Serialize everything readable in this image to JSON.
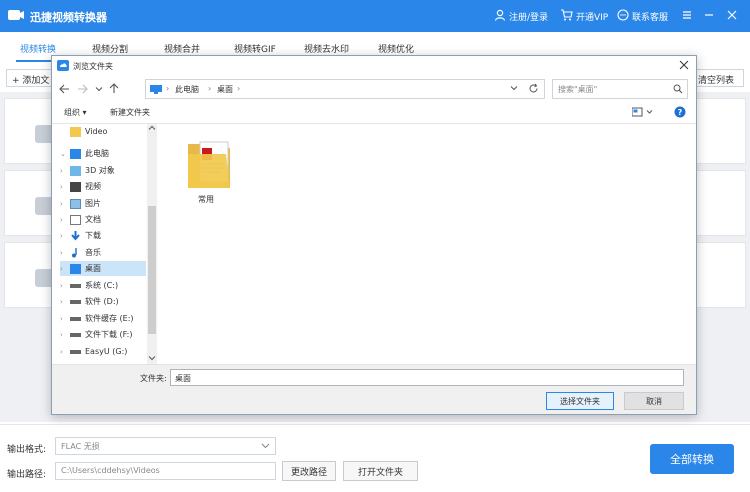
{
  "app": {
    "title": "迅捷视频转换器",
    "login_label": "注册/登录",
    "vip_label": "开通VIP",
    "service_label": "联系客服",
    "brand_color": "#2a86e8"
  },
  "nav": {
    "tabs": [
      {
        "label": "视频转换",
        "active": true
      },
      {
        "label": "视频分割",
        "active": false
      },
      {
        "label": "视频合并",
        "active": false
      },
      {
        "label": "视频转GIF",
        "active": false
      },
      {
        "label": "视频去水印",
        "active": false
      },
      {
        "label": "视频优化",
        "active": false
      }
    ]
  },
  "toolbar": {
    "add_label": "+ 添加文",
    "clear_label": "清空列表"
  },
  "bottom": {
    "format_label": "输出格式:",
    "format_value": "FLAC  无损",
    "path_label": "输出路径:",
    "path_value": "C:\\Users\\cddehsy\\Videos",
    "change_path_label": "更改路径",
    "open_folder_label": "打开文件夹",
    "convert_all_label": "全部转换"
  },
  "dialog": {
    "title": "浏览文件夹",
    "breadcrumb": [
      "此电脑",
      "桌面"
    ],
    "search_placeholder": "搜索\"桌面\"",
    "organize_label": "组织 ▾",
    "new_folder_label": "新建文件夹",
    "tree": [
      {
        "label": "Video",
        "icon": "folder-icon",
        "level": 1,
        "selected": false
      },
      {
        "label": "此电脑",
        "icon": "pc-icon",
        "level": 0,
        "selected": false,
        "expanded": true
      },
      {
        "label": "3D 对象",
        "icon": "3d-icon",
        "level": 1,
        "selected": false
      },
      {
        "label": "视频",
        "icon": "video-icon",
        "level": 1,
        "selected": false
      },
      {
        "label": "图片",
        "icon": "picture-icon",
        "level": 1,
        "selected": false
      },
      {
        "label": "文档",
        "icon": "document-icon",
        "level": 1,
        "selected": false
      },
      {
        "label": "下载",
        "icon": "download-icon",
        "level": 1,
        "selected": false
      },
      {
        "label": "音乐",
        "icon": "music-icon",
        "level": 1,
        "selected": false
      },
      {
        "label": "桌面",
        "icon": "desktop-icon",
        "level": 1,
        "selected": true
      },
      {
        "label": "系统 (C:)",
        "icon": "drive-icon",
        "level": 1,
        "selected": false
      },
      {
        "label": "软件 (D:)",
        "icon": "drive-icon",
        "level": 1,
        "selected": false
      },
      {
        "label": "软件缓存 (E:)",
        "icon": "drive-icon",
        "level": 1,
        "selected": false
      },
      {
        "label": "文件下载 (F:)",
        "icon": "drive-icon",
        "level": 1,
        "selected": false
      },
      {
        "label": "EasyU (G:)",
        "icon": "drive-icon",
        "level": 1,
        "selected": false
      }
    ],
    "main_items": [
      {
        "label": "常用",
        "icon": "folder-icon"
      }
    ],
    "folder_label": "文件夹:",
    "folder_value": "桌面",
    "select_label": "选择文件夹",
    "cancel_label": "取消"
  }
}
